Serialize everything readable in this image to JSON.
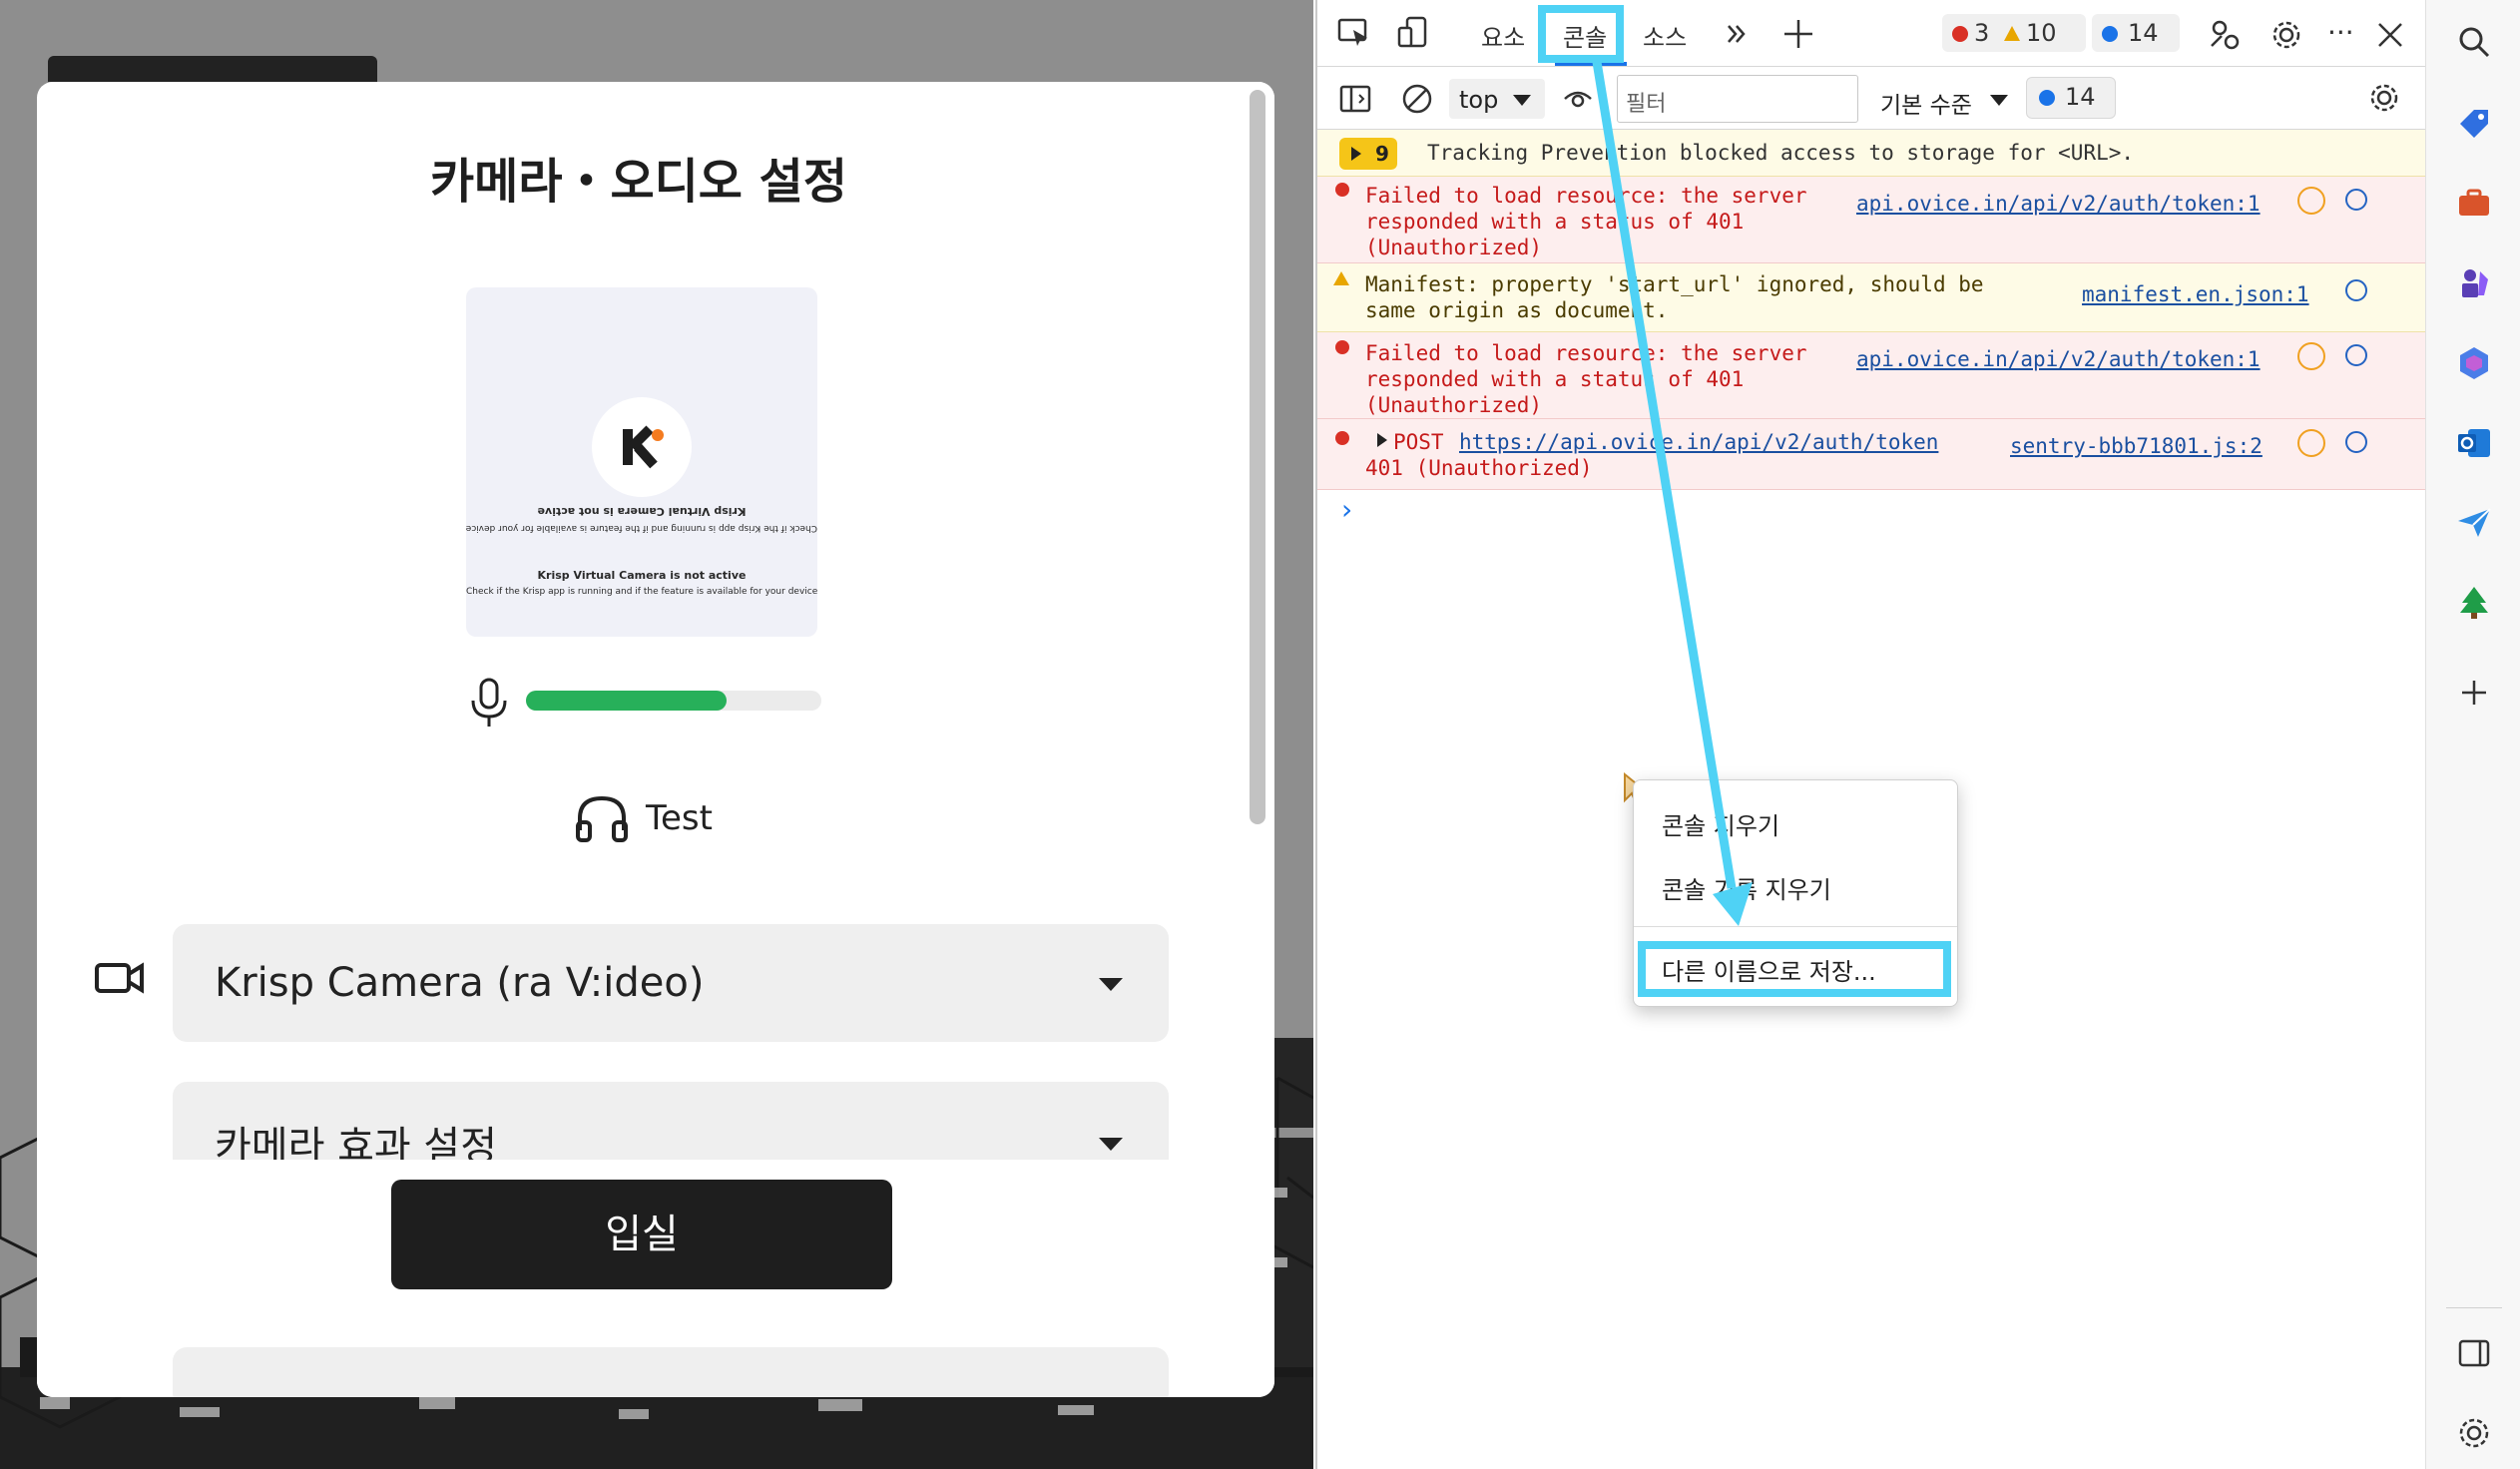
{
  "modal": {
    "title": "카메라・오디오 설정",
    "camera_preview": {
      "mirror_title": "Krisp Virtual Camera is not active",
      "mirror_sub": "Check if the Krisp app is running and if the feature is available for your device",
      "title": "Krisp Virtual Camera is not active",
      "sub": "Check if the Krisp app is running and if the feature is available for your device"
    },
    "mic_level": 0.68,
    "test_label": "Test",
    "camera_select_value": "Krisp Camera (ra V:ideo)",
    "effects_select_value": "카메라 효과 설정",
    "enter_button": "입실"
  },
  "devtools": {
    "tabs": [
      "요소",
      "콘솔",
      "소스"
    ],
    "active_tab": "콘솔",
    "error_count": "3",
    "warning_count": "10",
    "info_count": "14",
    "context": "top",
    "filter_placeholder": "필터",
    "level_select": "기본 수준",
    "issues_count": "14",
    "tracking_badge": "9",
    "tracking_msg": "Tracking Prevention blocked access to storage for <URL>.",
    "messages": [
      {
        "type": "error",
        "text": "Failed to load resource: the server\nresponded with a status of 401\n(Unauthorized)",
        "link": "api.ovice.in/api/v2/auth/token:1"
      },
      {
        "type": "warning",
        "text": "Manifest: property 'start_url' ignored, should be\nsame origin as document.",
        "link": "manifest.en.json:1"
      },
      {
        "type": "error",
        "text": "Failed to load resource: the server\nresponded with a status of 401\n(Unauthorized)",
        "link": "api.ovice.in/api/v2/auth/token:1"
      },
      {
        "type": "error",
        "prefix": "POST",
        "url": "https://api.ovice.in/api/v2/auth/token",
        "text": "401 (Unauthorized)",
        "link": "sentry-bbb71801.js:2"
      }
    ],
    "prompt": "›"
  },
  "context_menu": {
    "items": [
      "콘솔 지우기",
      "콘솔 기록 지우기",
      "다른 이름으로 저장..."
    ]
  },
  "colors": {
    "highlight": "#4fd2f5",
    "error": "#c51a1a",
    "meter": "#27b05a"
  }
}
